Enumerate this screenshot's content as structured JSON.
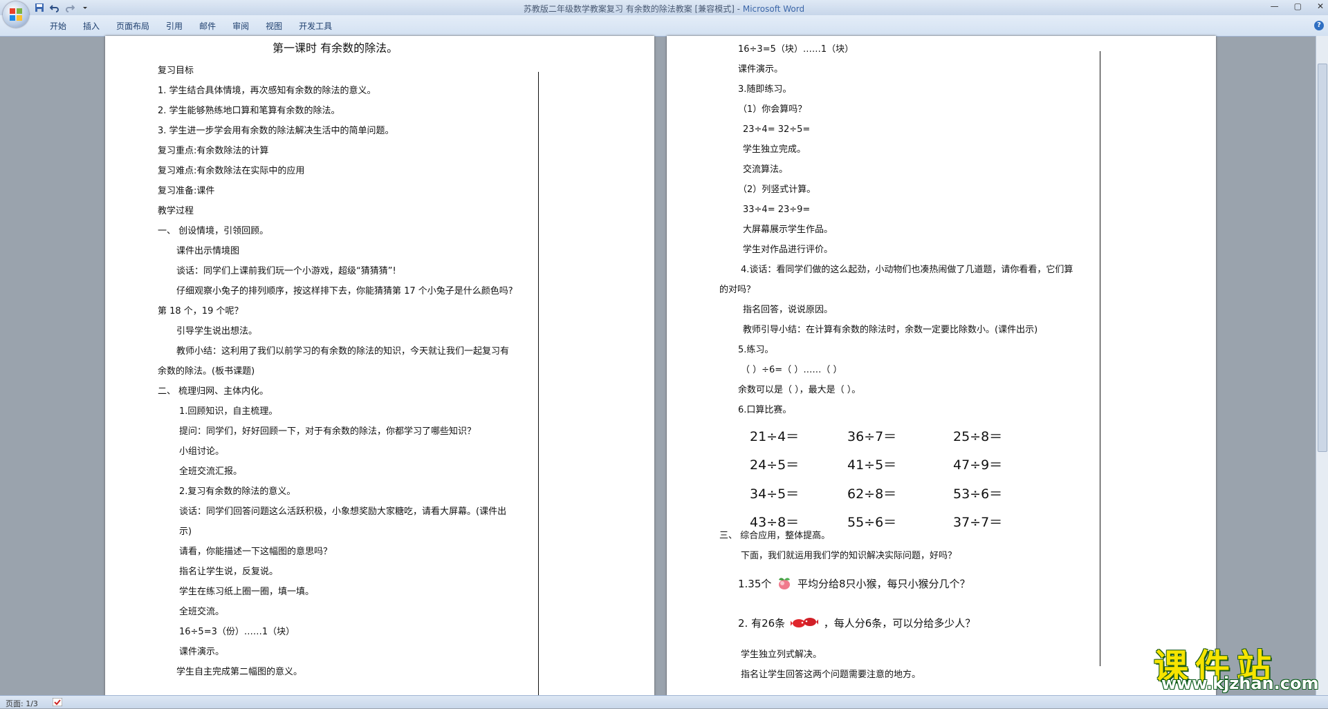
{
  "window": {
    "doc_name": "苏教版二年级数学教案复习 有余数的除法教案 [兼容模式] - ",
    "app_name": "Microsoft Word",
    "controls": [
      "—",
      "▢",
      "✕"
    ]
  },
  "ribbon": {
    "tabs": [
      "开始",
      "插入",
      "页面布局",
      "引用",
      "邮件",
      "审阅",
      "视图",
      "开发工具"
    ]
  },
  "status": {
    "page": "页面: 1/3"
  },
  "page1": {
    "title": "第一课时  有余数的除法。",
    "lines": [
      "复习目标",
      "1. 学生结合具体情境，再次感知有余数的除法的意义。",
      "2. 学生能够熟练地口算和笔算有余数的除法。",
      "3. 学生进一步学会用有余数的除法解决生活中的简单问题。",
      "复习重点:有余数除法的计算",
      "复习难点:有余数除法在实际中的应用",
      "复习准备:课件",
      "教学过程",
      "一、 创设情境，引领回顾。",
      "课件出示情境图",
      "谈话：同学们上课前我们玩一个小游戏，超级“猜猜猜”!",
      "仔细观察小兔子的排列顺序，按这样排下去，你能猜猜第 17 个小兔子是什么颜色吗?",
      "第 18 个，19 个呢？",
      "引导学生说出想法。",
      "教师小结：这利用了我们以前学习的有余数的除法的知识，今天就让我们一起复习有",
      "余数的除法。(板书课题)",
      "二、 梳理归网、主体内化。",
      "1.回顾知识，自主梳理。",
      "提问：同学们，好好回顾一下，对于有余数的除法，你都学习了哪些知识？",
      "小组讨论。",
      "全班交流汇报。",
      "2.复习有余数的除法的意义。",
      "谈话：同学们回答问题这么活跃积极，小象想奖励大家糖吃，请看大屏幕。(课件出",
      "示)",
      "请看，你能描述一下这幅图的意思吗？",
      "指名让学生说，反复说。",
      "学生在练习纸上圈一圈，填一填。",
      "全班交流。",
      "16÷5=3（份）……1（块）",
      "课件演示。",
      "学生自主完成第二幅图的意义。"
    ]
  },
  "page2": {
    "lines": [
      "16÷3=5（块）……1（块）",
      "课件演示。",
      "3.随即练习。",
      "（1）你会算吗？",
      "23÷4=          32÷5=",
      "学生独立完成。",
      "交流算法。",
      "（2）列竖式计算。",
      "33÷4=          23÷9=",
      "大屏幕展示学生作品。",
      "学生对作品进行评价。",
      "4.谈话：看同学们做的这么起劲，小动物们也凑热闹做了几道题，请你看看，它们算",
      "的对吗？",
      "指名回答，说说原因。",
      "教师引导小结：在计算有余数的除法时，余数一定要比除数小。(课件出示)",
      "5.练习。",
      "（  ）÷6=（  ）……（  ）",
      "余数可以是（         ），最大是（     ）。",
      "6.口算比赛。"
    ],
    "oral": [
      [
        "21÷4＝",
        "36÷7＝",
        "25÷8＝"
      ],
      [
        "24÷5＝",
        "41÷5＝",
        "47÷9＝"
      ],
      [
        "34÷5＝",
        "62÷8＝",
        "53÷6＝"
      ],
      [
        "43÷8＝",
        "55÷6＝",
        "37÷7＝"
      ]
    ],
    "section3": "三、 综合应用，整体提高。",
    "intro": "下面，我们就运用我们学的知识解决实际问题，好吗？",
    "q1_pre": "1.35个",
    "q1_post": "平均分给8只小猴，每只小猴分几个？",
    "q2_pre": "2. 有26条",
    "q2_post": "，每人分6条，可以分给多少人？",
    "tail": [
      "学生独立列式解决。",
      "指名让学生回答这两个问题需要注意的地方。"
    ]
  },
  "watermark": {
    "title": "课件站",
    "url": "www.kjzhan.com"
  },
  "colors": {
    "ribbon": "#d3e1f2",
    "background": "#9aa3ad",
    "wm_yellow": "#f6e400",
    "wm_green": "#1a5a1a"
  }
}
